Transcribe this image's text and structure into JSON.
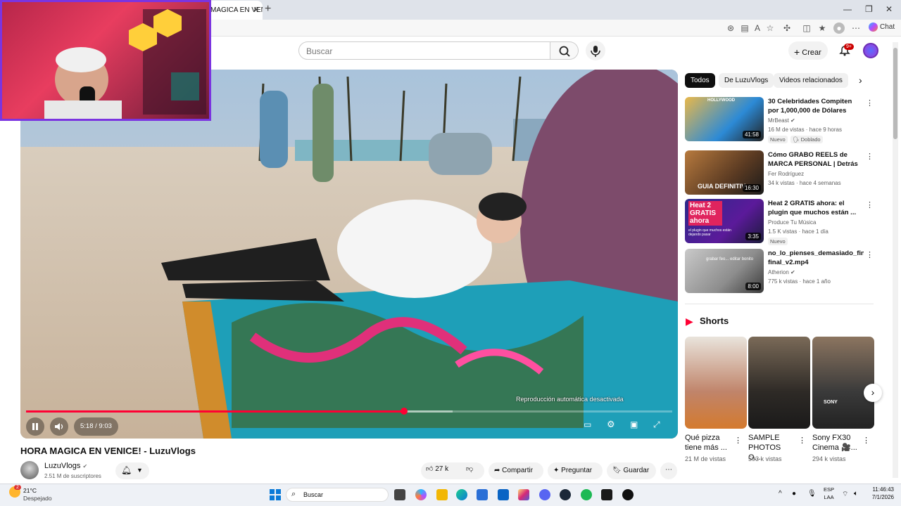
{
  "browser": {
    "tab_title": "MAGICA EN VENICE!",
    "new_tab": "+",
    "chat_label": "Chat",
    "window_controls": [
      "—",
      "❐",
      "✕"
    ]
  },
  "header": {
    "search_placeholder": "Buscar",
    "create_label": "Crear",
    "notifications_badge": "9+"
  },
  "player": {
    "time": "5:18 / 9:03",
    "progress": 0.585,
    "buffered": 0.66,
    "autoplay_text": "Reproducción automática desactivada"
  },
  "video": {
    "title": "HORA MAGICA EN VENICE! - LuzuVlogs",
    "channel": "LuzuVlogs",
    "subscribers": "2.51 M de suscriptores",
    "likes": "27 k",
    "share": "Compartir",
    "ask": "Preguntar",
    "save": "Guardar"
  },
  "chips": [
    "Todos",
    "De LuzuVlogs",
    "Videos relacionados"
  ],
  "recommendations": [
    {
      "title": "30 Celebridades Compiten por 1,000,000 de Dólares",
      "channel": "MrBeast",
      "meta": "16 M de vistas · hace 9 horas",
      "duration": "41:58",
      "badges": [
        "Nuevo",
        "Doblado"
      ],
      "thumb_text": "HOLLYWOOD"
    },
    {
      "title": "Cómo GRABO REELS de MARCA PERSONAL | Detrás d...",
      "channel": "Fer Rodríguez",
      "meta": "34 k vistas · hace 4 semanas",
      "duration": "16:30",
      "badges": [],
      "thumb_text": "GUIA DEFINITIV"
    },
    {
      "title": "Heat 2 GRATIS ahora: el plugin que muchos están ...",
      "channel": "Produce Tu Música",
      "meta": "1.5 K vistas · hace 1 día",
      "duration": "3:35",
      "badges": [
        "Nuevo"
      ],
      "thumb_text": "Heat 2 GRATIS ahora",
      "thumb_sub": "el plugin que muchos están dejando pasar"
    },
    {
      "title": "no_lo_pienses_demasiado_final final_v2.mp4",
      "channel": "Atherion",
      "meta": "775 k vistas · hace 1 año",
      "duration": "8:00",
      "badges": [],
      "thumb_text": "grabar feo... editar bonito"
    }
  ],
  "shorts": {
    "heading": "Shorts",
    "items": [
      {
        "title": "Qué pizza tiene más ...",
        "views": "21 M de vistas"
      },
      {
        "title": "SAMPLE PHOTOS O...",
        "views": "593 k vistas"
      },
      {
        "title": "Sony FX30 Cinema 🎥...",
        "views": "294 k vistas",
        "thumb_text": "SONY"
      }
    ]
  },
  "taskbar": {
    "weather_temp": "21°C",
    "weather_desc": "Despejado",
    "weather_badge": "2",
    "search": "Buscar",
    "lang": "ESP",
    "lang2": "LAA",
    "time": "11:46:43",
    "date": "7/1/2026"
  }
}
